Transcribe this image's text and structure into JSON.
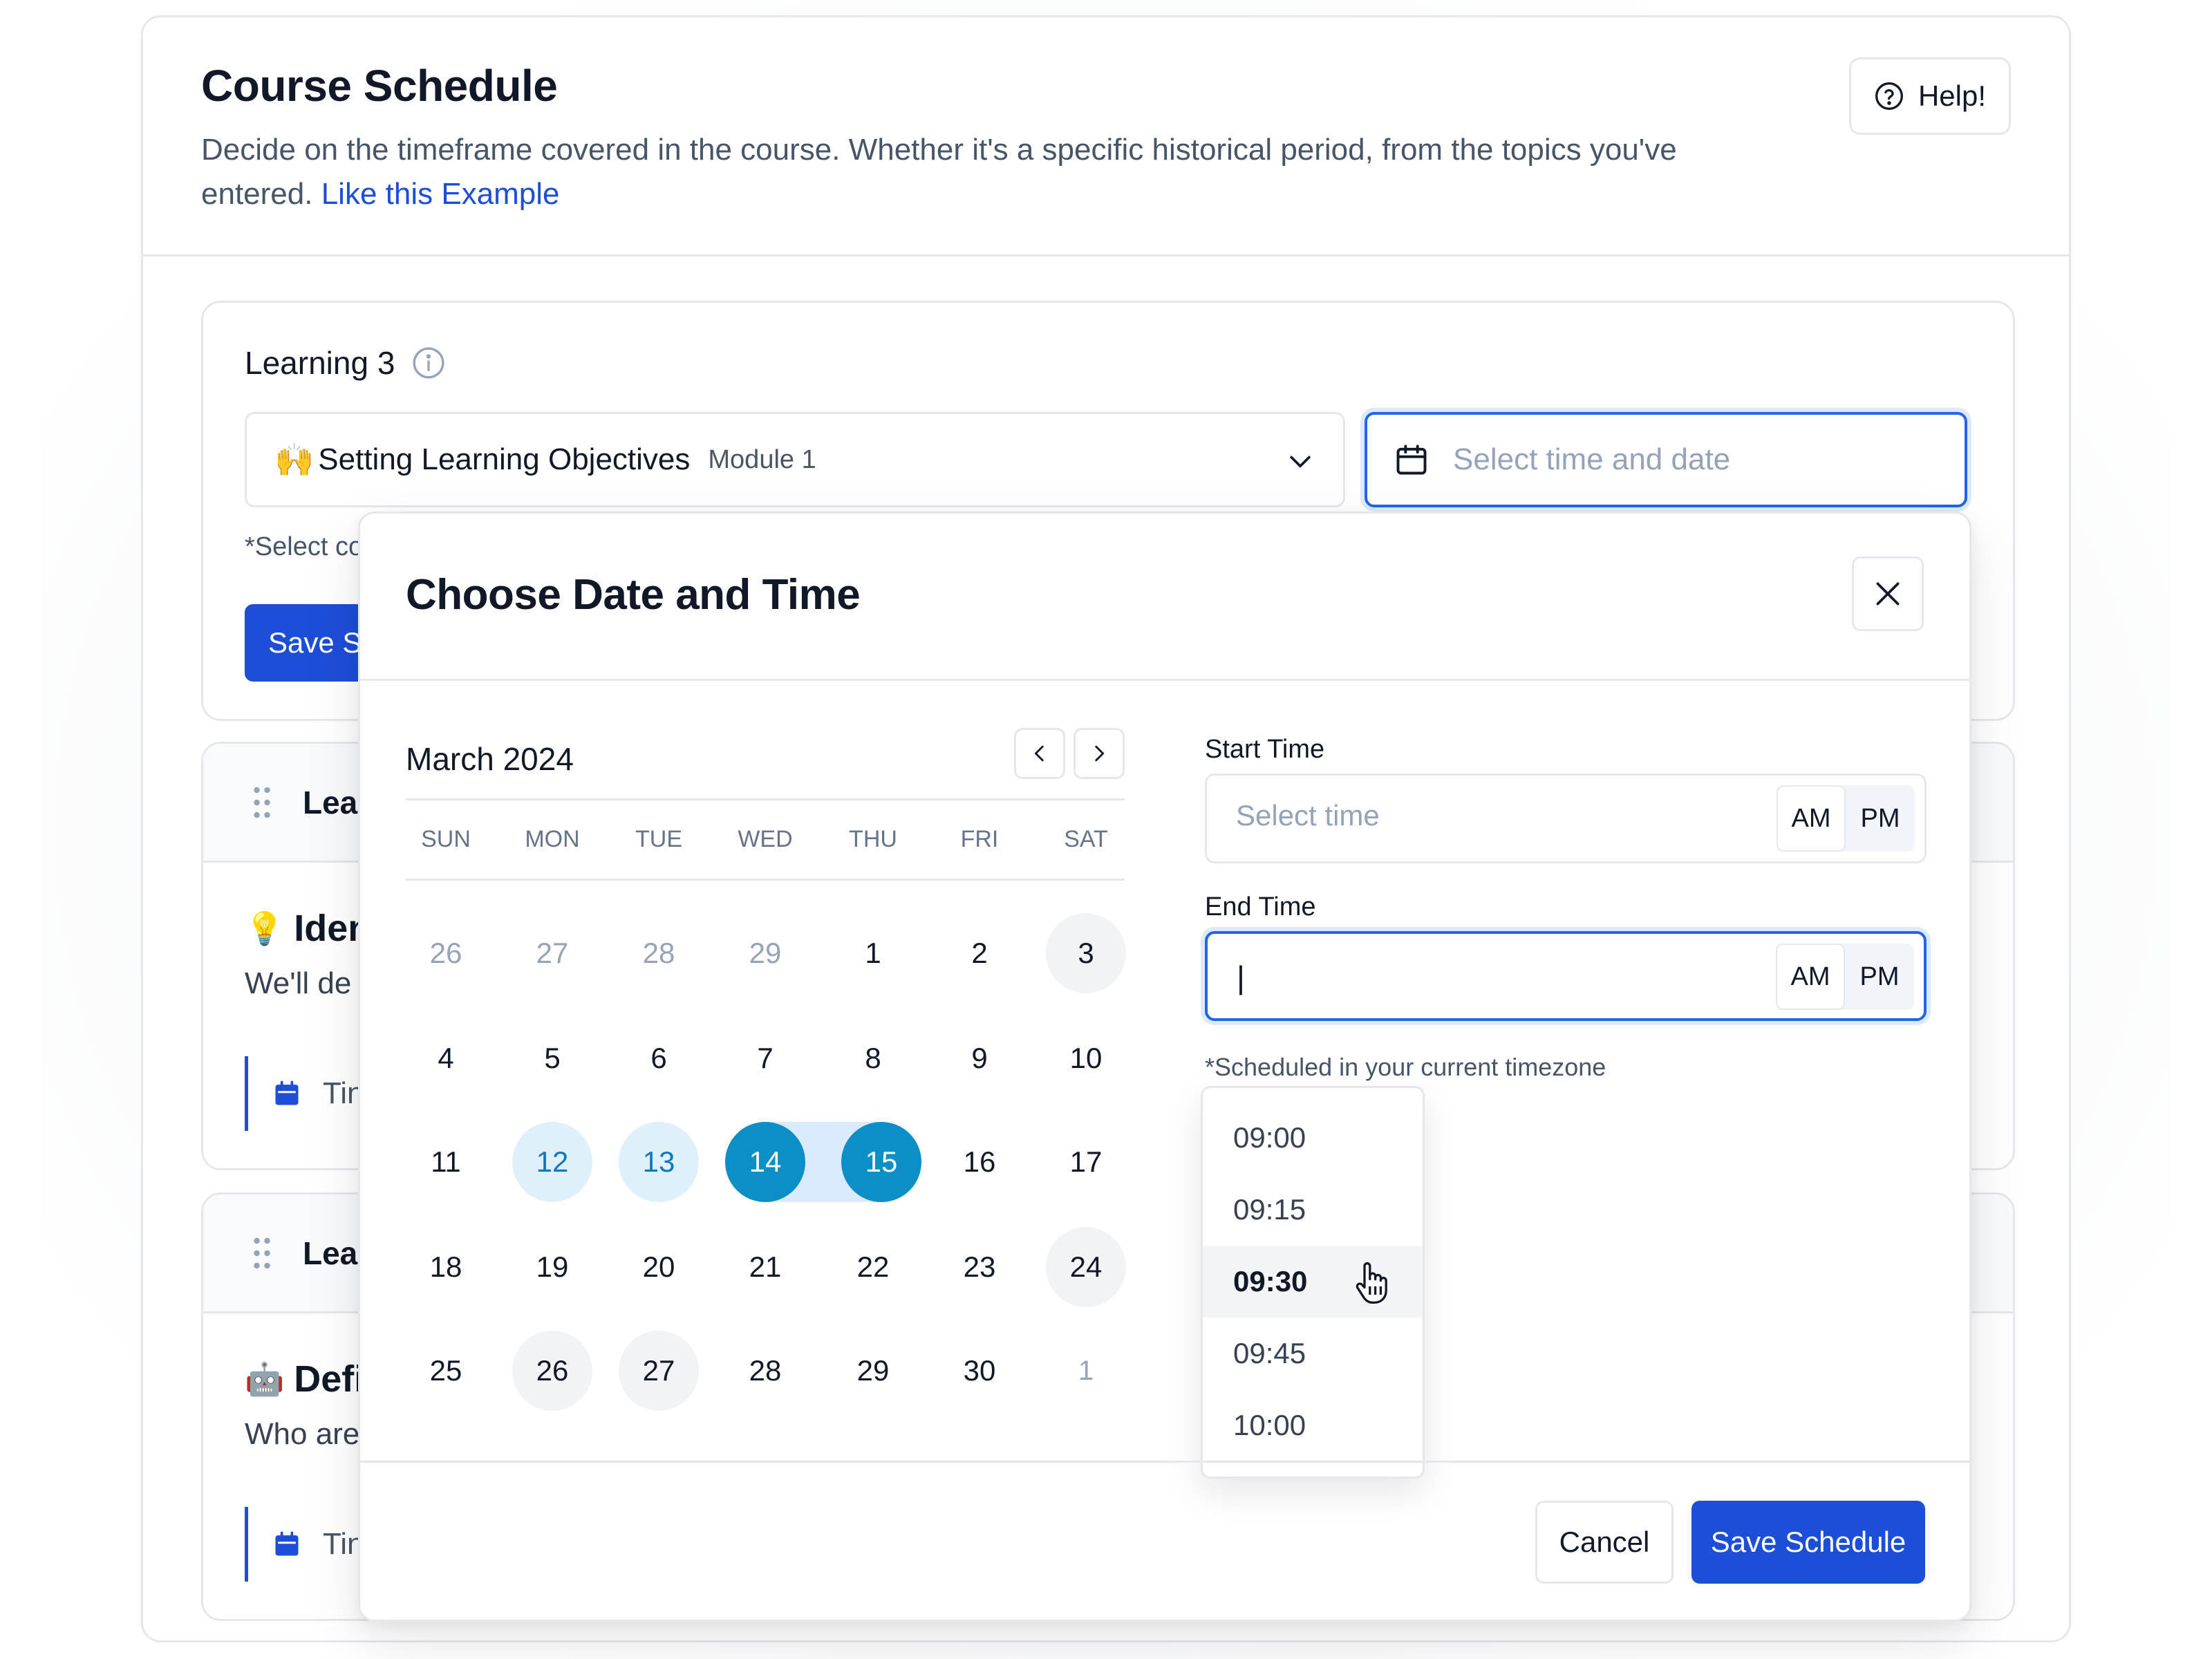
{
  "page": {
    "title": "Course Schedule",
    "description": "Decide on the timeframe covered in the course.  Whether it's a specific historical period, from the topics you've entered.",
    "example_link": "Like this Example",
    "help_label": "Help!"
  },
  "learning": {
    "label": "Learning 3",
    "module_emoji": "🙌",
    "module_name": "Setting Learning Objectives",
    "module_sub": "Module 1",
    "date_placeholder": "Select time and date",
    "hint": "*Select co",
    "save_label": "Save Sc"
  },
  "sections": [
    {
      "head": "Lea",
      "emoji": "💡",
      "title": "Iden",
      "desc": "We'll de",
      "time": "Tin"
    },
    {
      "head": "Lea",
      "emoji": "🤖",
      "title": "Defi",
      "desc": "Who are",
      "time": "Tin"
    }
  ],
  "modal": {
    "title": "Choose Date and Time",
    "month": "March 2024",
    "weekdays": [
      "SUN",
      "MON",
      "TUE",
      "WED",
      "THU",
      "FRI",
      "SAT"
    ],
    "weeks": [
      [
        "26",
        "27",
        "28",
        "29",
        "1",
        "2",
        "3"
      ],
      [
        "4",
        "5",
        "6",
        "7",
        "8",
        "9",
        "10"
      ],
      [
        "11",
        "12",
        "13",
        "14",
        "15",
        "16",
        "17"
      ],
      [
        "18",
        "19",
        "20",
        "21",
        "22",
        "23",
        "24"
      ],
      [
        "25",
        "26",
        "27",
        "28",
        "29",
        "30",
        "1"
      ]
    ],
    "selected_range": [
      "14",
      "15"
    ],
    "start_label": "Start Time",
    "start_placeholder": "Select time",
    "end_label": "End Time",
    "end_value": "|",
    "am": "AM",
    "pm": "PM",
    "tz_note": "*Scheduled in your current timezone",
    "time_options": [
      "09:00",
      "09:15",
      "09:30",
      "09:45",
      "10:00"
    ],
    "hovered_time": "09:30",
    "cancel_label": "Cancel",
    "save_label": "Save Schedule"
  },
  "colors": {
    "primary": "#1d4ed8",
    "selected_day": "#0b8fc6",
    "range_light": "#e0f0fb"
  }
}
